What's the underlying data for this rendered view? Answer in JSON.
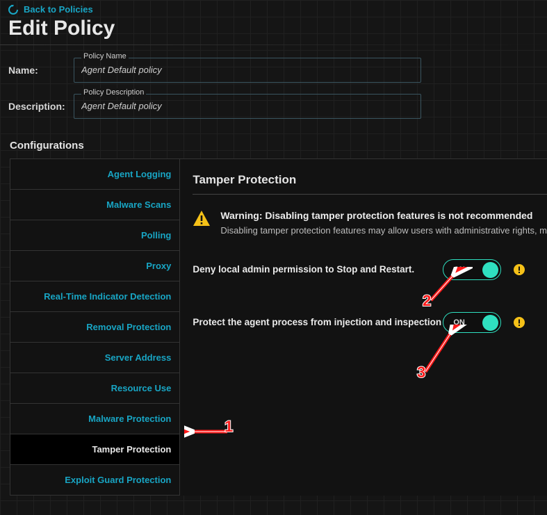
{
  "backLink": "Back to Policies",
  "pageTitle": "Edit Policy",
  "nameRow": {
    "label": "Name:",
    "legend": "Policy Name",
    "value": "Agent Default policy"
  },
  "descRow": {
    "label": "Description:",
    "legend": "Policy Description",
    "value": "Agent Default policy"
  },
  "configHeader": "Configurations",
  "sidebar": {
    "items": [
      {
        "label": "Agent Logging"
      },
      {
        "label": "Malware Scans"
      },
      {
        "label": "Polling"
      },
      {
        "label": "Proxy"
      },
      {
        "label": "Real-Time Indicator Detection"
      },
      {
        "label": "Removal Protection"
      },
      {
        "label": "Server Address"
      },
      {
        "label": "Resource Use"
      },
      {
        "label": "Malware Protection"
      },
      {
        "label": "Tamper Protection"
      },
      {
        "label": "Exploit Guard Protection"
      }
    ],
    "activeIndex": 9
  },
  "panel": {
    "title": "Tamper Protection",
    "warningTitle": "Warning: Disabling tamper protection features is not recommended",
    "warningBody": "Disabling tamper protection features may allow users with administrative rights, m",
    "settings": [
      {
        "label": "Deny local admin permission to Stop and Restart.",
        "state": "ON"
      },
      {
        "label": "Protect the agent process from injection and inspection",
        "state": "ON"
      }
    ]
  },
  "anno": {
    "n1": "1",
    "n2": "2",
    "n3": "3"
  },
  "colors": {
    "accent": "#19a6c5",
    "toggle": "#2fe0c0",
    "warn": "#f5c118"
  }
}
